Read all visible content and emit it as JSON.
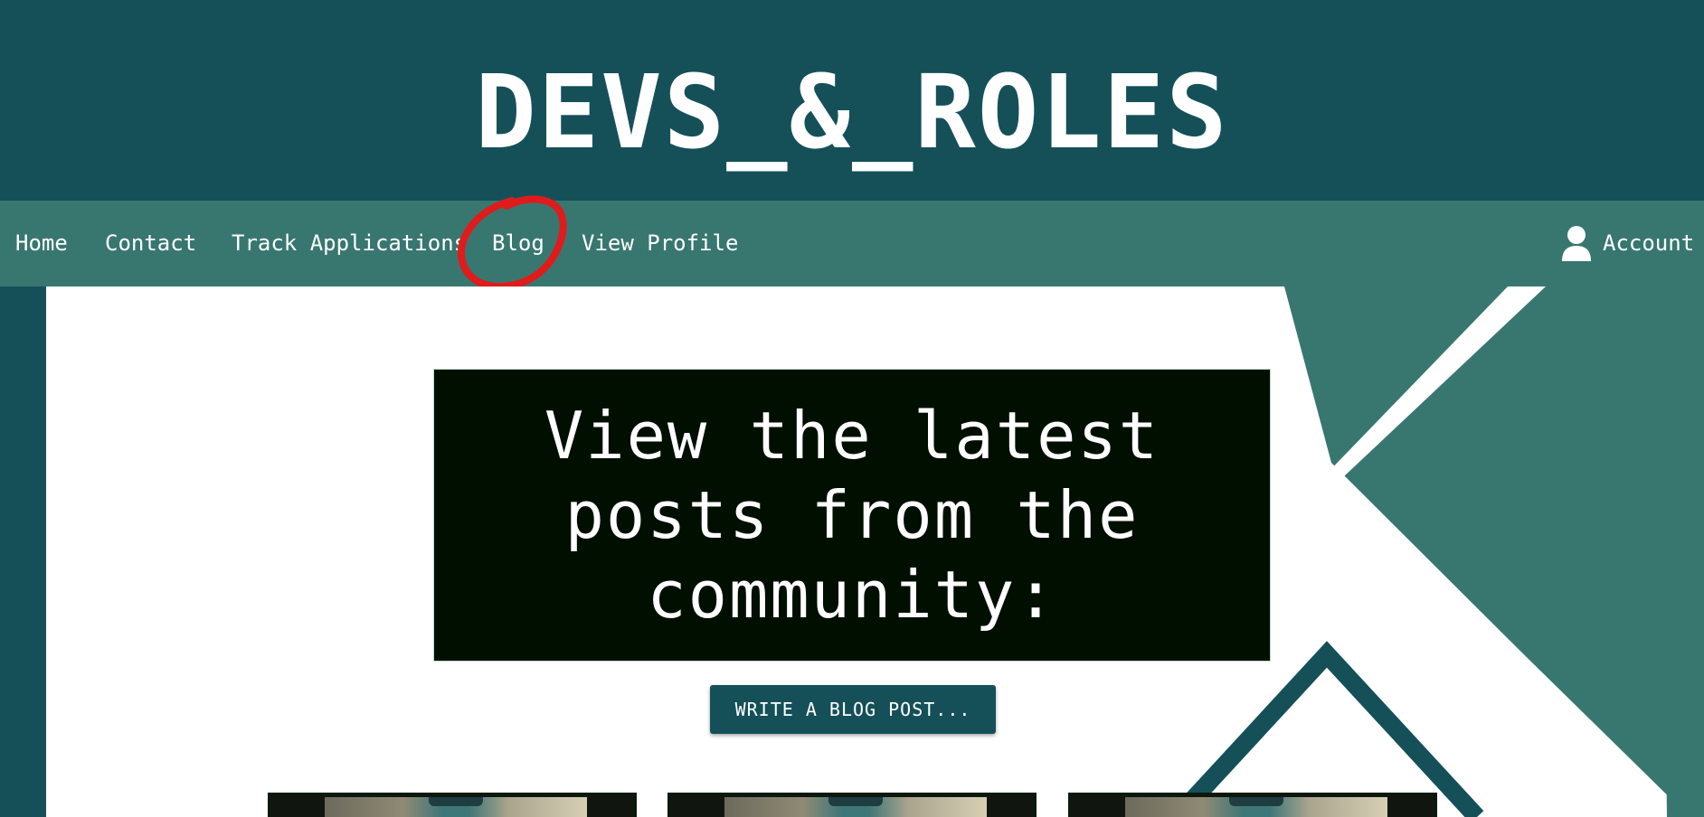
{
  "header": {
    "site_title": "DEVS_&_ROLES"
  },
  "nav": {
    "items": [
      {
        "label": "Home"
      },
      {
        "label": "Contact"
      },
      {
        "label": "Track Applications"
      },
      {
        "label": "Blog"
      },
      {
        "label": "View Profile"
      }
    ],
    "account": {
      "label": "Account",
      "icon": "user-icon"
    },
    "highlighted_item": "Blog"
  },
  "main": {
    "hero_text": "View the latest posts from the community:",
    "write_button_label": "WRITE A BLOG POST...",
    "post_cards": [
      {
        "thumbnail": "blog-post-thumbnail"
      },
      {
        "thumbnail": "blog-post-thumbnail"
      },
      {
        "thumbnail": "blog-post-thumbnail"
      }
    ]
  },
  "colors": {
    "header_bg": "#155059",
    "nav_bg": "#387770",
    "hero_bg": "#000f00",
    "button_bg": "#155059",
    "highlight_circle": "#e01b1b"
  }
}
